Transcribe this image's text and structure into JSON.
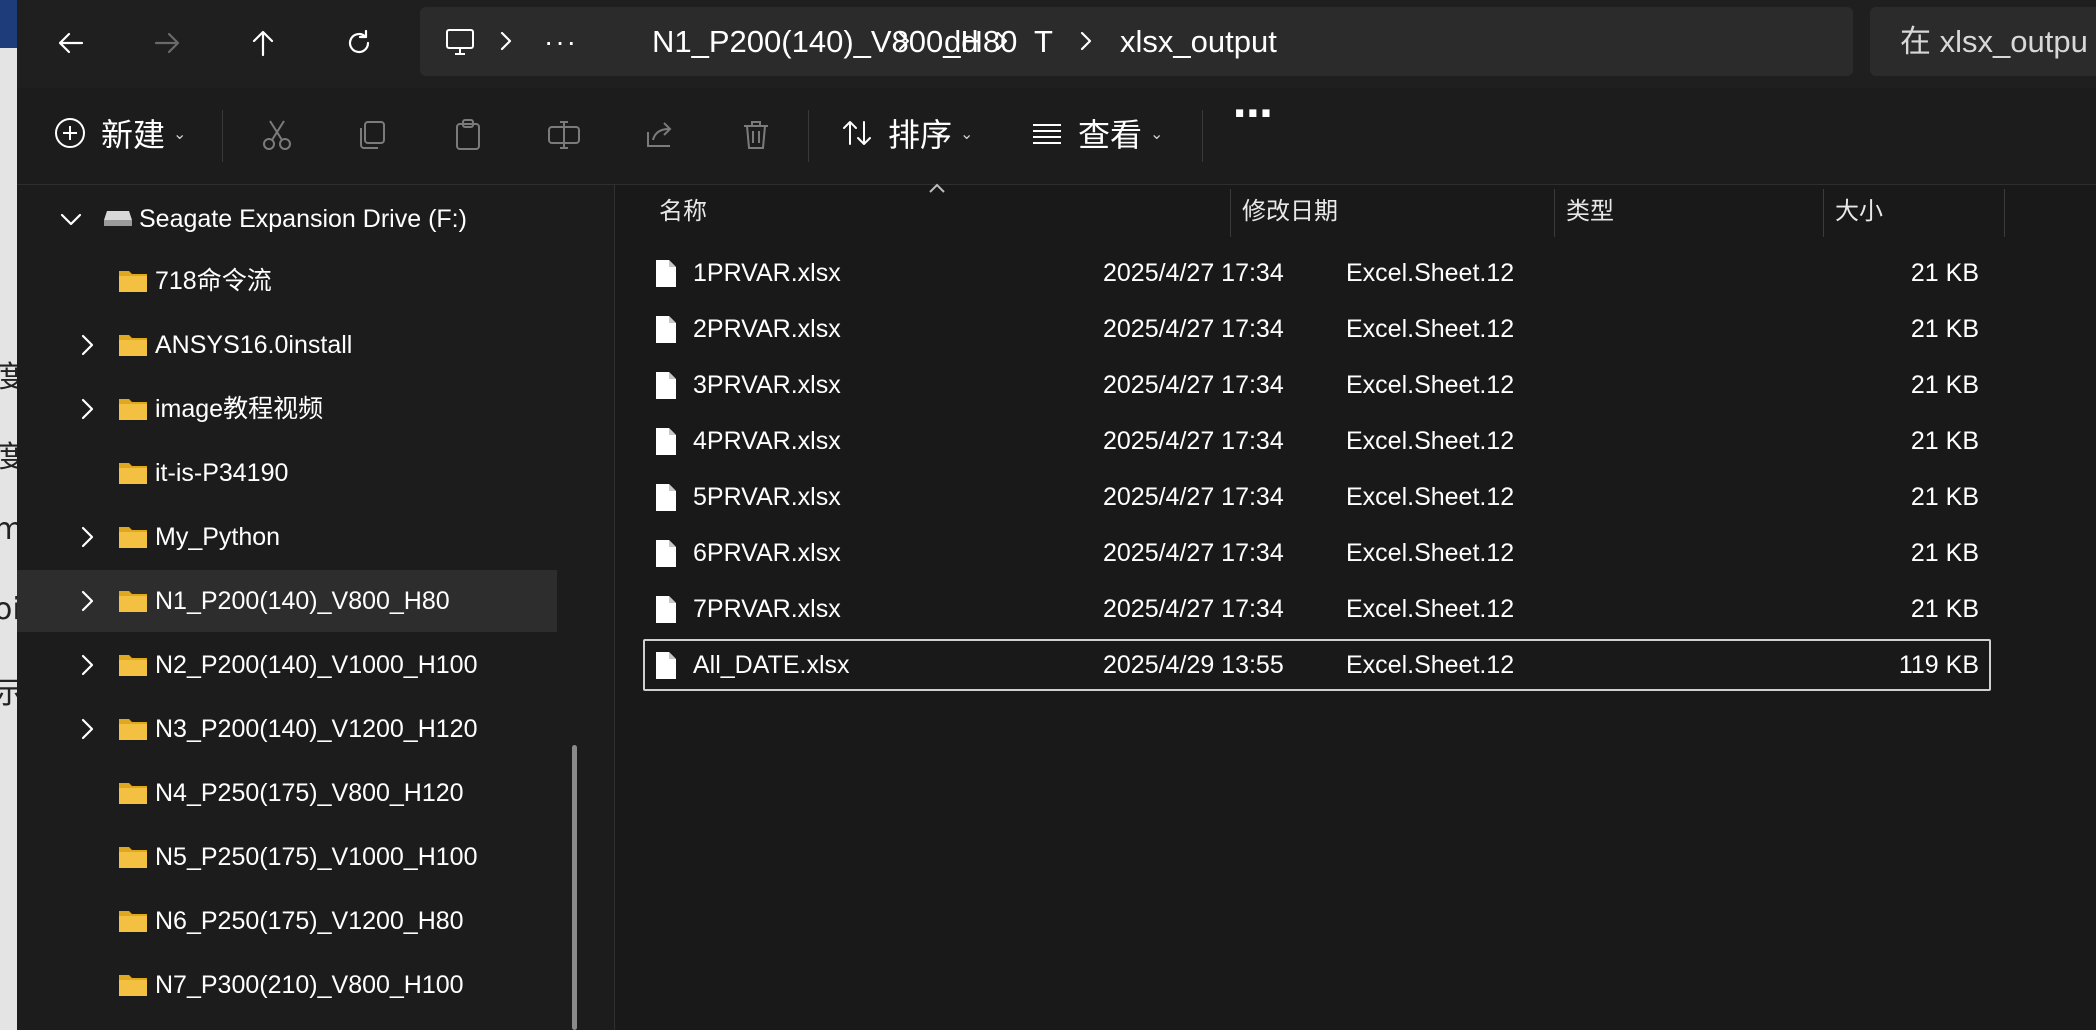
{
  "window": {
    "address_bar": {
      "segments": [
        "N1_P200(140)_V800_H80",
        "dd",
        "T",
        "xlsx_output"
      ],
      "overflow_label": "···",
      "root_icon": "this-pc-icon"
    },
    "search": {
      "placeholder": "在 xlsx_output 中搜索",
      "visible_text": "在 xlsx_outpu"
    }
  },
  "nav_buttons": {
    "back": "back-arrow-icon",
    "forward": "forward-arrow-icon",
    "up": "up-arrow-icon",
    "refresh": "refresh-icon"
  },
  "command_bar": {
    "new_label": "新建",
    "sort_label": "排序",
    "view_label": "查看",
    "more_label": "···",
    "disabled_icons": [
      "cut-icon",
      "copy-icon",
      "paste-icon",
      "rename-icon",
      "share-icon",
      "delete-icon"
    ]
  },
  "nav_pane": {
    "items": [
      {
        "label": "Seagate Expansion Drive (F:)",
        "expanded": true,
        "type": "drive"
      },
      {
        "label": "718命令流",
        "expandable": false
      },
      {
        "label": "ANSYS16.0install",
        "expandable": true
      },
      {
        "label": "image教程视频",
        "expandable": true
      },
      {
        "label": "it-is-P34190",
        "expandable": false
      },
      {
        "label": "My_Python",
        "expandable": true
      },
      {
        "label": "N1_P200(140)_V800_H80",
        "expandable": true,
        "selected": true
      },
      {
        "label": "N2_P200(140)_V1000_H100",
        "expandable": true
      },
      {
        "label": "N3_P200(140)_V1200_H120",
        "expandable": true
      },
      {
        "label": "N4_P250(175)_V800_H120",
        "expandable": false
      },
      {
        "label": "N5_P250(175)_V1000_H100",
        "expandable": false
      },
      {
        "label": "N6_P250(175)_V1200_H80",
        "expandable": false
      },
      {
        "label": "N7_P300(210)_V800_H100",
        "expandable": false
      }
    ]
  },
  "file_list": {
    "columns": {
      "name": "名称",
      "modified": "修改日期",
      "type": "类型",
      "size": "大小"
    },
    "sorted_by": "name",
    "files": [
      {
        "name": "1PRVAR.xlsx",
        "modified": "2025/4/27 17:34",
        "type": "Excel.Sheet.12",
        "size": "21 KB"
      },
      {
        "name": "2PRVAR.xlsx",
        "modified": "2025/4/27 17:34",
        "type": "Excel.Sheet.12",
        "size": "21 KB"
      },
      {
        "name": "3PRVAR.xlsx",
        "modified": "2025/4/27 17:34",
        "type": "Excel.Sheet.12",
        "size": "21 KB"
      },
      {
        "name": "4PRVAR.xlsx",
        "modified": "2025/4/27 17:34",
        "type": "Excel.Sheet.12",
        "size": "21 KB"
      },
      {
        "name": "5PRVAR.xlsx",
        "modified": "2025/4/27 17:34",
        "type": "Excel.Sheet.12",
        "size": "21 KB"
      },
      {
        "name": "6PRVAR.xlsx",
        "modified": "2025/4/27 17:34",
        "type": "Excel.Sheet.12",
        "size": "21 KB"
      },
      {
        "name": "7PRVAR.xlsx",
        "modified": "2025/4/27 17:34",
        "type": "Excel.Sheet.12",
        "size": "21 KB"
      },
      {
        "name": "All_DATE.xlsx",
        "modified": "2025/4/29 13:55",
        "type": "Excel.Sheet.12",
        "size": "119 KB",
        "focused": true
      }
    ]
  },
  "background_window": {
    "glyphs": [
      "度",
      "度",
      "m",
      "oi",
      "示"
    ]
  },
  "colors": {
    "folder": "#f4c042",
    "folder_dark": "#e0a81c",
    "selection": "#2d2d2d",
    "text": "#ffffff"
  }
}
